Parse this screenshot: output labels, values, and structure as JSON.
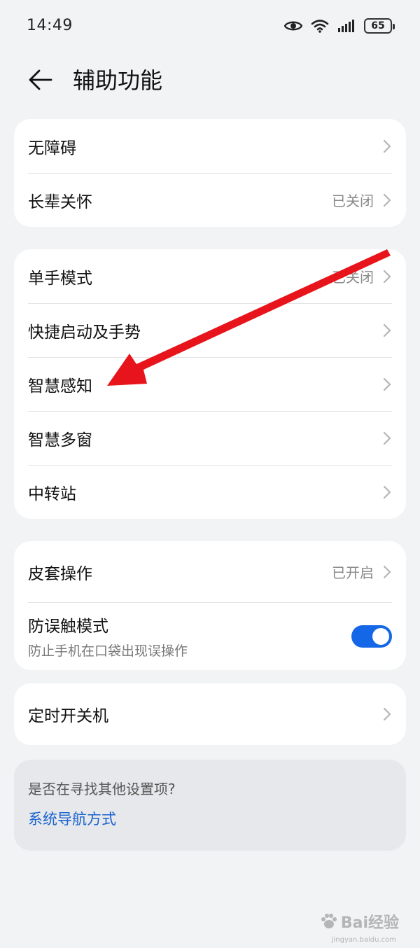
{
  "status_bar": {
    "time": "14:49",
    "battery": "65",
    "icons": [
      "eye-icon",
      "wifi-icon",
      "signal-icon",
      "battery-icon"
    ]
  },
  "header": {
    "back_icon": "arrow-left-icon",
    "title": "辅助功能"
  },
  "group1": [
    {
      "label": "无障碍",
      "value": ""
    },
    {
      "label": "长辈关怀",
      "value": "已关闭"
    }
  ],
  "group2": [
    {
      "label": "单手模式",
      "value": "已关闭"
    },
    {
      "label": "快捷启动及手势",
      "value": ""
    },
    {
      "label": "智慧感知",
      "value": ""
    },
    {
      "label": "智慧多窗",
      "value": ""
    },
    {
      "label": "中转站",
      "value": ""
    }
  ],
  "group3": {
    "cover": {
      "label": "皮套操作",
      "value": "已开启"
    },
    "mistouch": {
      "label": "防误触模式",
      "sub": "防止手机在口袋出现误操作",
      "enabled": true
    }
  },
  "group4": [
    {
      "label": "定时开关机",
      "value": ""
    }
  ],
  "suggest": {
    "question": "是否在寻找其他设置项?",
    "link": "系统导航方式"
  },
  "colors": {
    "accent": "#1467e6",
    "link": "#1a62cf",
    "annotation": "#e8141b",
    "background": "#f1f3f5"
  },
  "watermark": {
    "text": "Bai经验",
    "sub": "jingyan.baidu.com"
  }
}
